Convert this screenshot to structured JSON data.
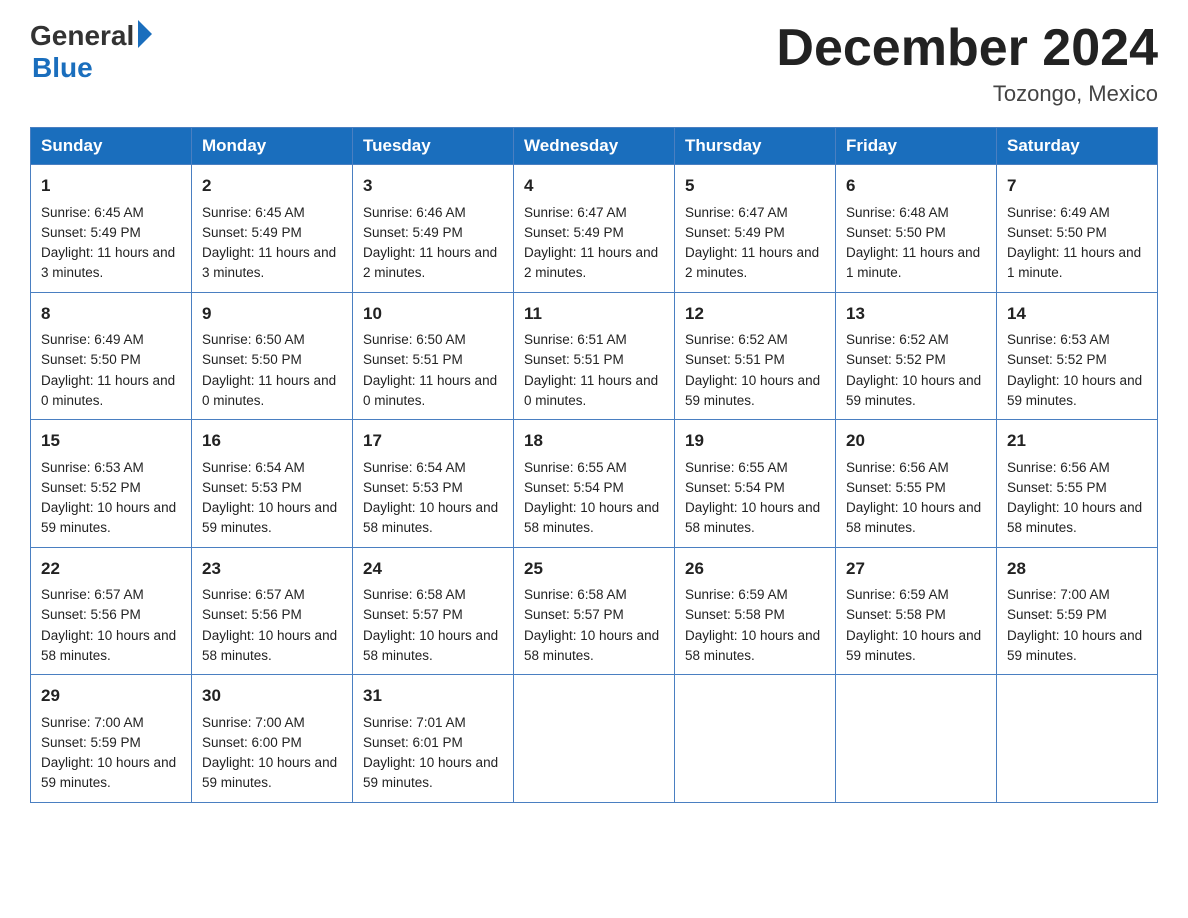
{
  "header": {
    "logo_general": "General",
    "logo_blue": "Blue",
    "month_title": "December 2024",
    "location": "Tozongo, Mexico"
  },
  "days_of_week": [
    "Sunday",
    "Monday",
    "Tuesday",
    "Wednesday",
    "Thursday",
    "Friday",
    "Saturday"
  ],
  "weeks": [
    [
      {
        "day": 1,
        "sunrise": "6:45 AM",
        "sunset": "5:49 PM",
        "daylight": "11 hours and 3 minutes."
      },
      {
        "day": 2,
        "sunrise": "6:45 AM",
        "sunset": "5:49 PM",
        "daylight": "11 hours and 3 minutes."
      },
      {
        "day": 3,
        "sunrise": "6:46 AM",
        "sunset": "5:49 PM",
        "daylight": "11 hours and 2 minutes."
      },
      {
        "day": 4,
        "sunrise": "6:47 AM",
        "sunset": "5:49 PM",
        "daylight": "11 hours and 2 minutes."
      },
      {
        "day": 5,
        "sunrise": "6:47 AM",
        "sunset": "5:49 PM",
        "daylight": "11 hours and 2 minutes."
      },
      {
        "day": 6,
        "sunrise": "6:48 AM",
        "sunset": "5:50 PM",
        "daylight": "11 hours and 1 minute."
      },
      {
        "day": 7,
        "sunrise": "6:49 AM",
        "sunset": "5:50 PM",
        "daylight": "11 hours and 1 minute."
      }
    ],
    [
      {
        "day": 8,
        "sunrise": "6:49 AM",
        "sunset": "5:50 PM",
        "daylight": "11 hours and 0 minutes."
      },
      {
        "day": 9,
        "sunrise": "6:50 AM",
        "sunset": "5:50 PM",
        "daylight": "11 hours and 0 minutes."
      },
      {
        "day": 10,
        "sunrise": "6:50 AM",
        "sunset": "5:51 PM",
        "daylight": "11 hours and 0 minutes."
      },
      {
        "day": 11,
        "sunrise": "6:51 AM",
        "sunset": "5:51 PM",
        "daylight": "11 hours and 0 minutes."
      },
      {
        "day": 12,
        "sunrise": "6:52 AM",
        "sunset": "5:51 PM",
        "daylight": "10 hours and 59 minutes."
      },
      {
        "day": 13,
        "sunrise": "6:52 AM",
        "sunset": "5:52 PM",
        "daylight": "10 hours and 59 minutes."
      },
      {
        "day": 14,
        "sunrise": "6:53 AM",
        "sunset": "5:52 PM",
        "daylight": "10 hours and 59 minutes."
      }
    ],
    [
      {
        "day": 15,
        "sunrise": "6:53 AM",
        "sunset": "5:52 PM",
        "daylight": "10 hours and 59 minutes."
      },
      {
        "day": 16,
        "sunrise": "6:54 AM",
        "sunset": "5:53 PM",
        "daylight": "10 hours and 59 minutes."
      },
      {
        "day": 17,
        "sunrise": "6:54 AM",
        "sunset": "5:53 PM",
        "daylight": "10 hours and 58 minutes."
      },
      {
        "day": 18,
        "sunrise": "6:55 AM",
        "sunset": "5:54 PM",
        "daylight": "10 hours and 58 minutes."
      },
      {
        "day": 19,
        "sunrise": "6:55 AM",
        "sunset": "5:54 PM",
        "daylight": "10 hours and 58 minutes."
      },
      {
        "day": 20,
        "sunrise": "6:56 AM",
        "sunset": "5:55 PM",
        "daylight": "10 hours and 58 minutes."
      },
      {
        "day": 21,
        "sunrise": "6:56 AM",
        "sunset": "5:55 PM",
        "daylight": "10 hours and 58 minutes."
      }
    ],
    [
      {
        "day": 22,
        "sunrise": "6:57 AM",
        "sunset": "5:56 PM",
        "daylight": "10 hours and 58 minutes."
      },
      {
        "day": 23,
        "sunrise": "6:57 AM",
        "sunset": "5:56 PM",
        "daylight": "10 hours and 58 minutes."
      },
      {
        "day": 24,
        "sunrise": "6:58 AM",
        "sunset": "5:57 PM",
        "daylight": "10 hours and 58 minutes."
      },
      {
        "day": 25,
        "sunrise": "6:58 AM",
        "sunset": "5:57 PM",
        "daylight": "10 hours and 58 minutes."
      },
      {
        "day": 26,
        "sunrise": "6:59 AM",
        "sunset": "5:58 PM",
        "daylight": "10 hours and 58 minutes."
      },
      {
        "day": 27,
        "sunrise": "6:59 AM",
        "sunset": "5:58 PM",
        "daylight": "10 hours and 59 minutes."
      },
      {
        "day": 28,
        "sunrise": "7:00 AM",
        "sunset": "5:59 PM",
        "daylight": "10 hours and 59 minutes."
      }
    ],
    [
      {
        "day": 29,
        "sunrise": "7:00 AM",
        "sunset": "5:59 PM",
        "daylight": "10 hours and 59 minutes."
      },
      {
        "day": 30,
        "sunrise": "7:00 AM",
        "sunset": "6:00 PM",
        "daylight": "10 hours and 59 minutes."
      },
      {
        "day": 31,
        "sunrise": "7:01 AM",
        "sunset": "6:01 PM",
        "daylight": "10 hours and 59 minutes."
      },
      null,
      null,
      null,
      null
    ]
  ]
}
